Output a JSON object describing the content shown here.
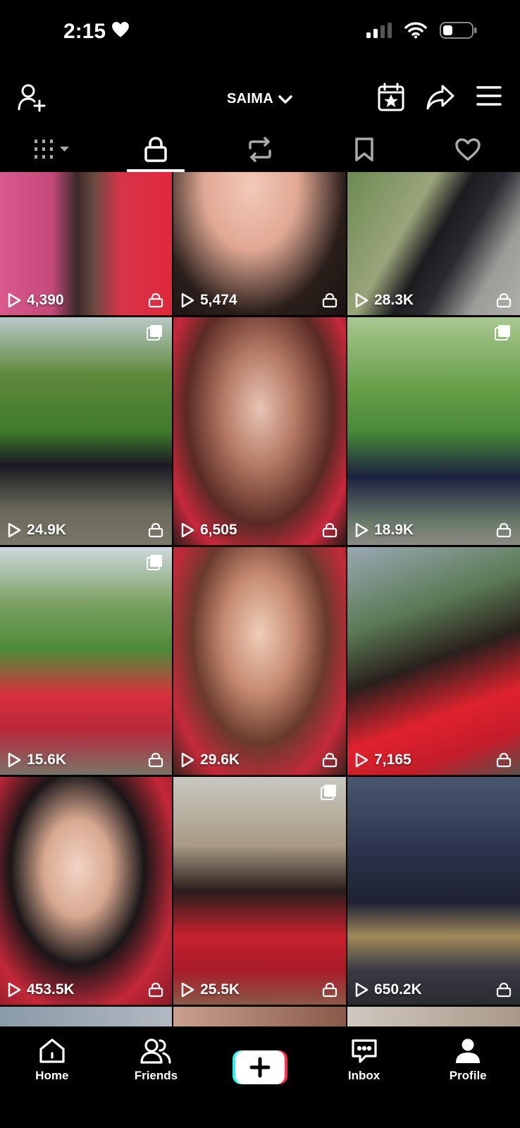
{
  "status_bar": {
    "time": "2:15"
  },
  "header": {
    "account_name": "SAIMA"
  },
  "grid": {
    "items": [
      {
        "views": "4,390"
      },
      {
        "views": "5,474"
      },
      {
        "views": "28.3K"
      },
      {
        "views": "24.9K"
      },
      {
        "views": "6,505"
      },
      {
        "views": "18.9K"
      },
      {
        "views": "15.6K"
      },
      {
        "views": "29.6K"
      },
      {
        "views": "7,165"
      },
      {
        "views": "453.5K"
      },
      {
        "views": "25.5K"
      },
      {
        "views": "650.2K"
      }
    ]
  },
  "nav": {
    "home": "Home",
    "friends": "Friends",
    "inbox": "Inbox",
    "profile": "Profile"
  }
}
